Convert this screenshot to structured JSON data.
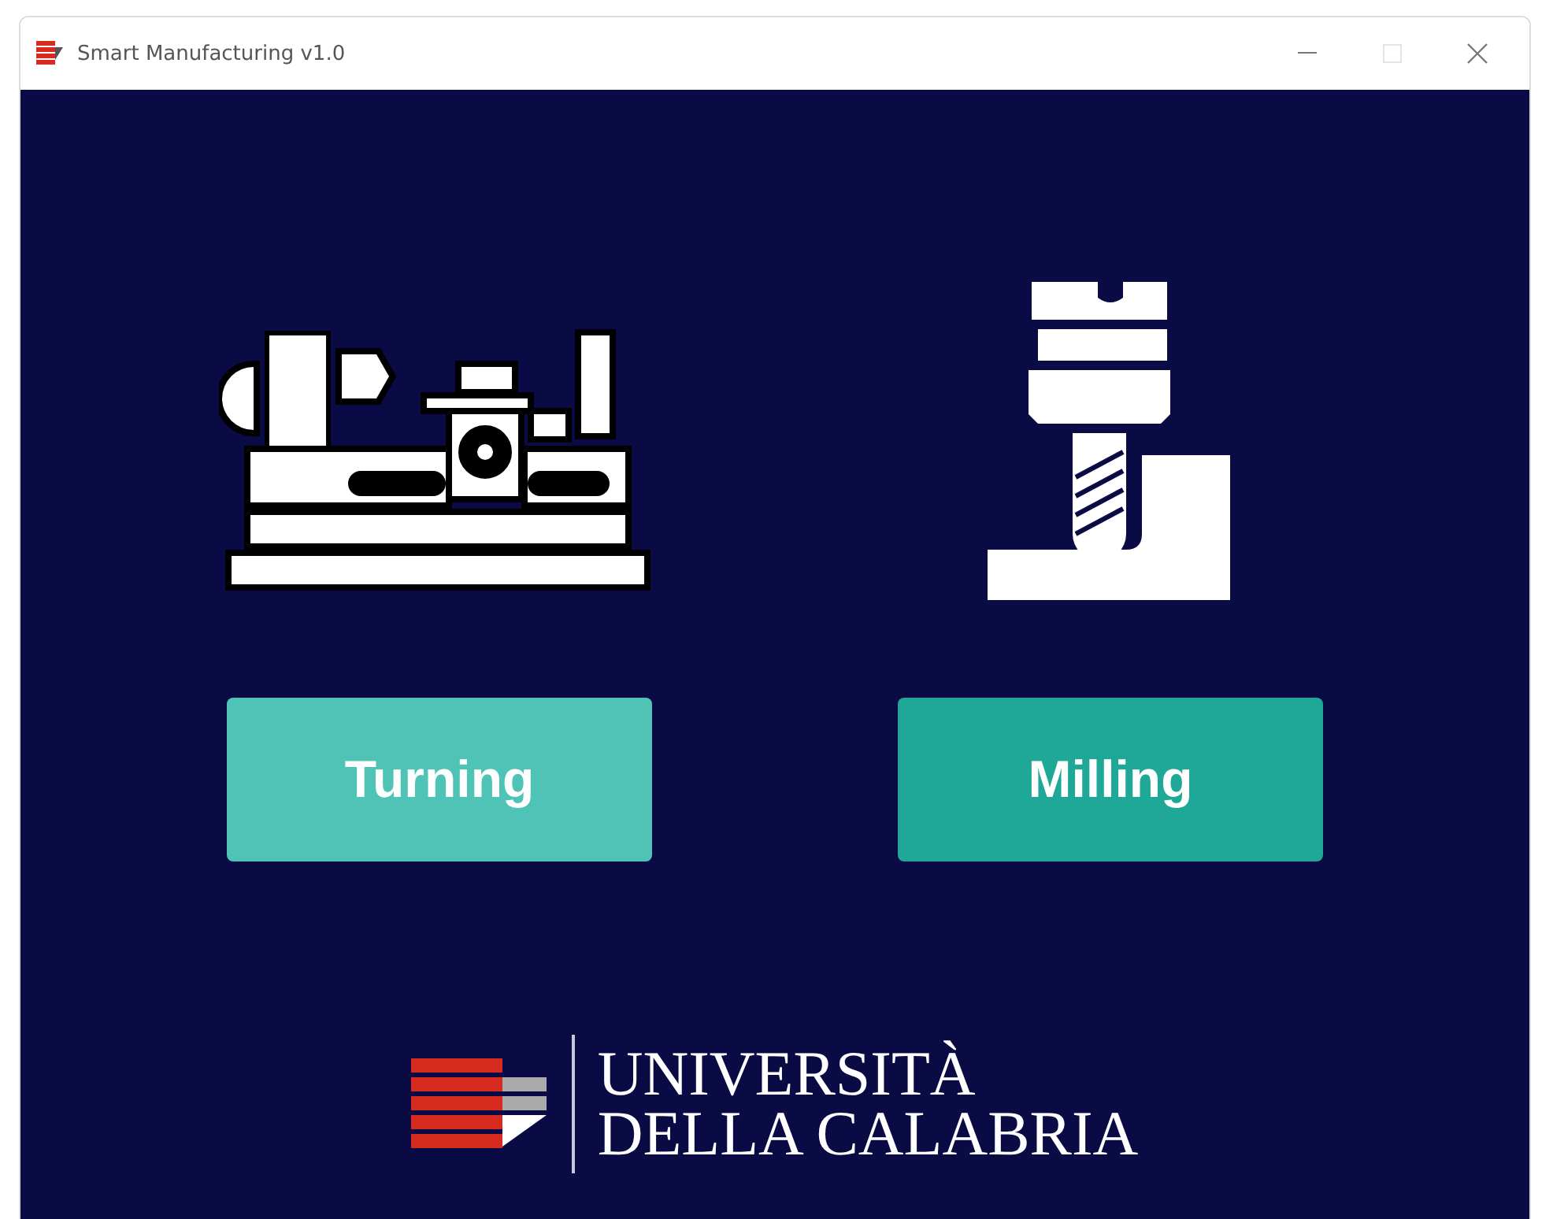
{
  "window": {
    "title": "Smart Manufacturing v1.0"
  },
  "machines": [
    {
      "kind": "lathe",
      "label": "Turning",
      "color": "#4fc4b6"
    },
    {
      "kind": "mill",
      "label": "Milling",
      "color": "#1fa898"
    }
  ],
  "logo": {
    "line_1": "UNIVERSITÀ",
    "line_2": "DELLA CALABRIA"
  }
}
